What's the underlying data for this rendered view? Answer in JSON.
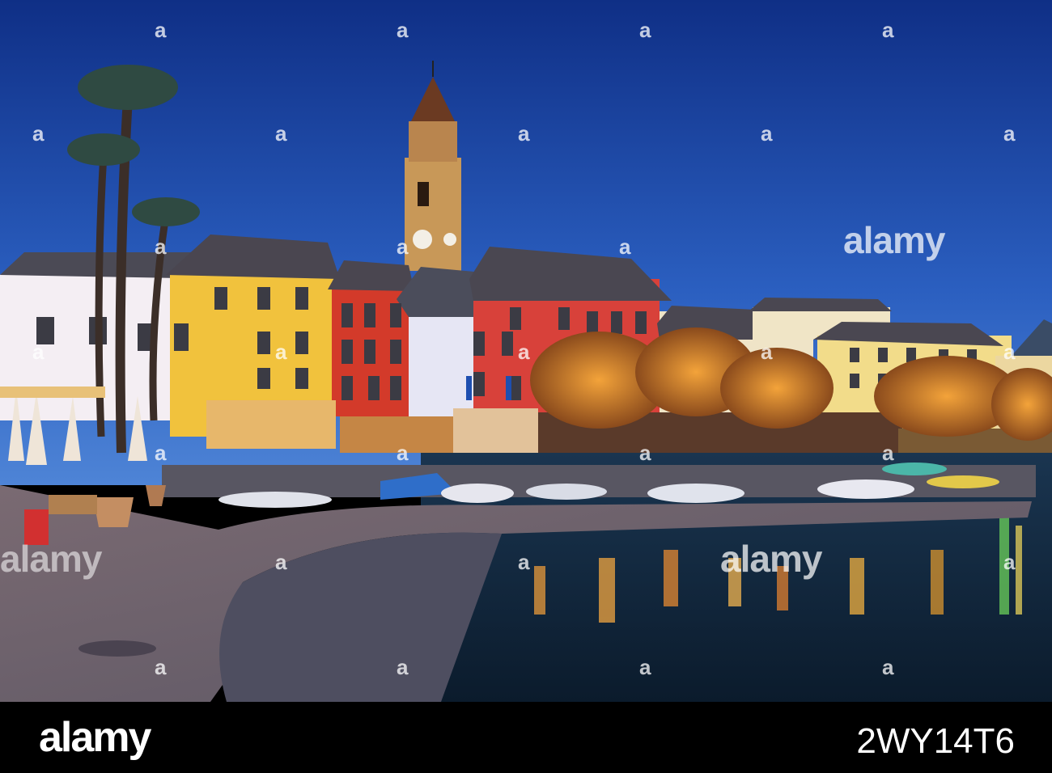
{
  "watermark": {
    "logo_text": "alamy",
    "side_mark": "a",
    "colors": {
      "text": "#ffffff"
    }
  },
  "footer": {
    "logo_text": "alamy",
    "image_id": "2WY14T6",
    "background": "#000000"
  },
  "scene": {
    "sky_top": "#123a8f",
    "sky_bottom": "#3a6fc7",
    "water": "#0e2436",
    "promenade": "#6e6470"
  }
}
